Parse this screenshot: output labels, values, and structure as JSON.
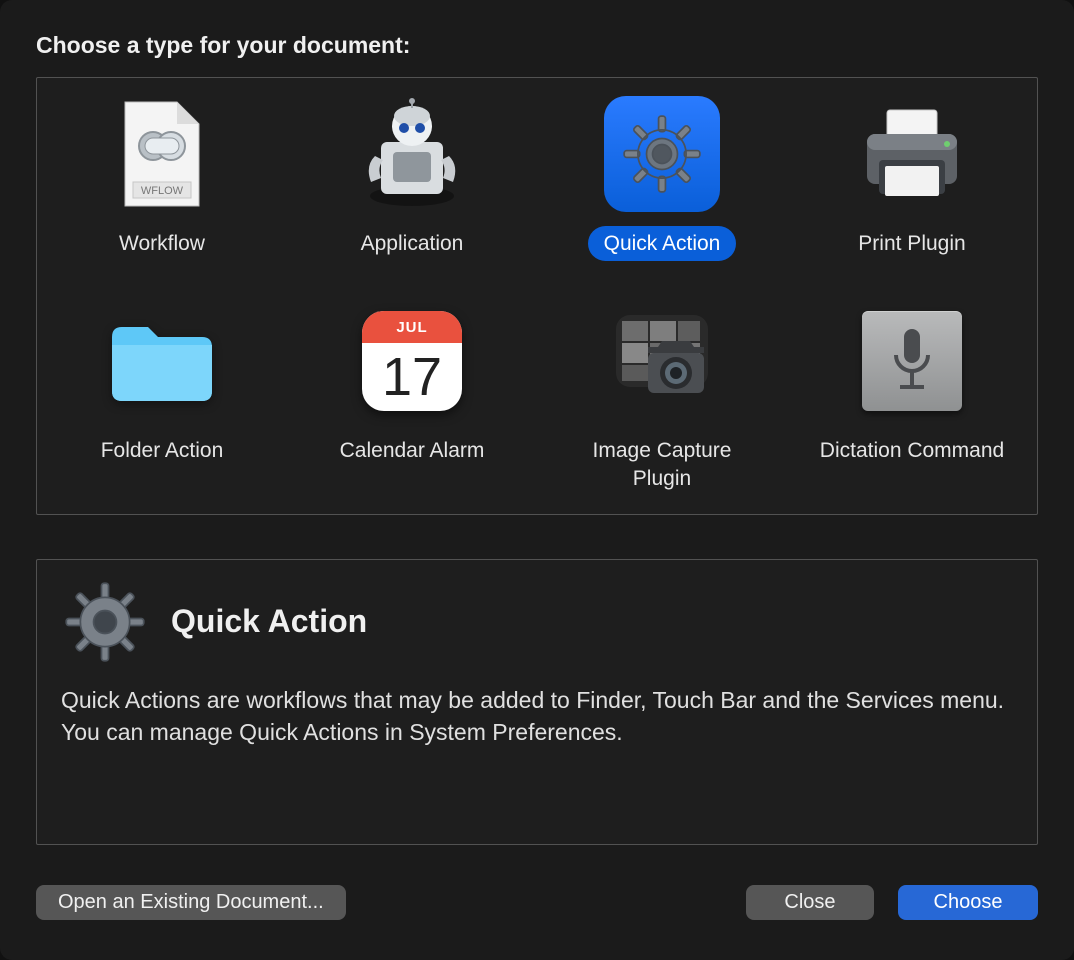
{
  "title": "Choose a type for your document:",
  "types": [
    {
      "id": "workflow",
      "label": "Workflow",
      "selected": false
    },
    {
      "id": "application",
      "label": "Application",
      "selected": false
    },
    {
      "id": "quick-action",
      "label": "Quick Action",
      "selected": true
    },
    {
      "id": "print-plugin",
      "label": "Print Plugin",
      "selected": false
    },
    {
      "id": "folder-action",
      "label": "Folder Action",
      "selected": false
    },
    {
      "id": "calendar-alarm",
      "label": "Calendar Alarm",
      "selected": false
    },
    {
      "id": "image-capture-plugin",
      "label": "Image Capture Plugin",
      "selected": false
    },
    {
      "id": "dictation-command",
      "label": "Dictation Command",
      "selected": false
    }
  ],
  "calendar": {
    "month": "JUL",
    "day": "17"
  },
  "workflow_badge": "WFLOW",
  "description": {
    "title": "Quick Action",
    "body": "Quick Actions are workflows that may be added to Finder, Touch Bar and the Services menu. You can manage Quick Actions in System Preferences."
  },
  "buttons": {
    "open_existing": "Open an Existing Document...",
    "close": "Close",
    "choose": "Choose"
  }
}
